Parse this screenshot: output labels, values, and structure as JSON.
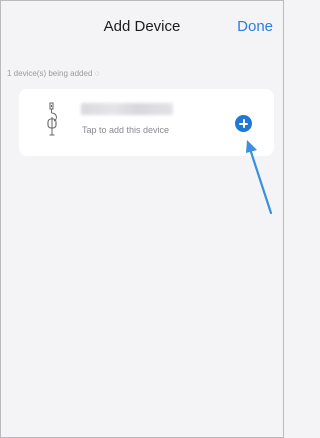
{
  "header": {
    "title": "Add Device",
    "done_label": "Done"
  },
  "status": {
    "text": "1 device(s) being added ◌"
  },
  "device_card": {
    "hint": "Tap to add this device"
  },
  "colors": {
    "accent": "#2a7de1",
    "add_button": "#1f78d6",
    "pointer_arrow": "#3b8fe0"
  },
  "icons": {
    "device": "device-plug-icon",
    "add": "add-circle-icon",
    "annotation": "pointer-arrow-icon"
  }
}
